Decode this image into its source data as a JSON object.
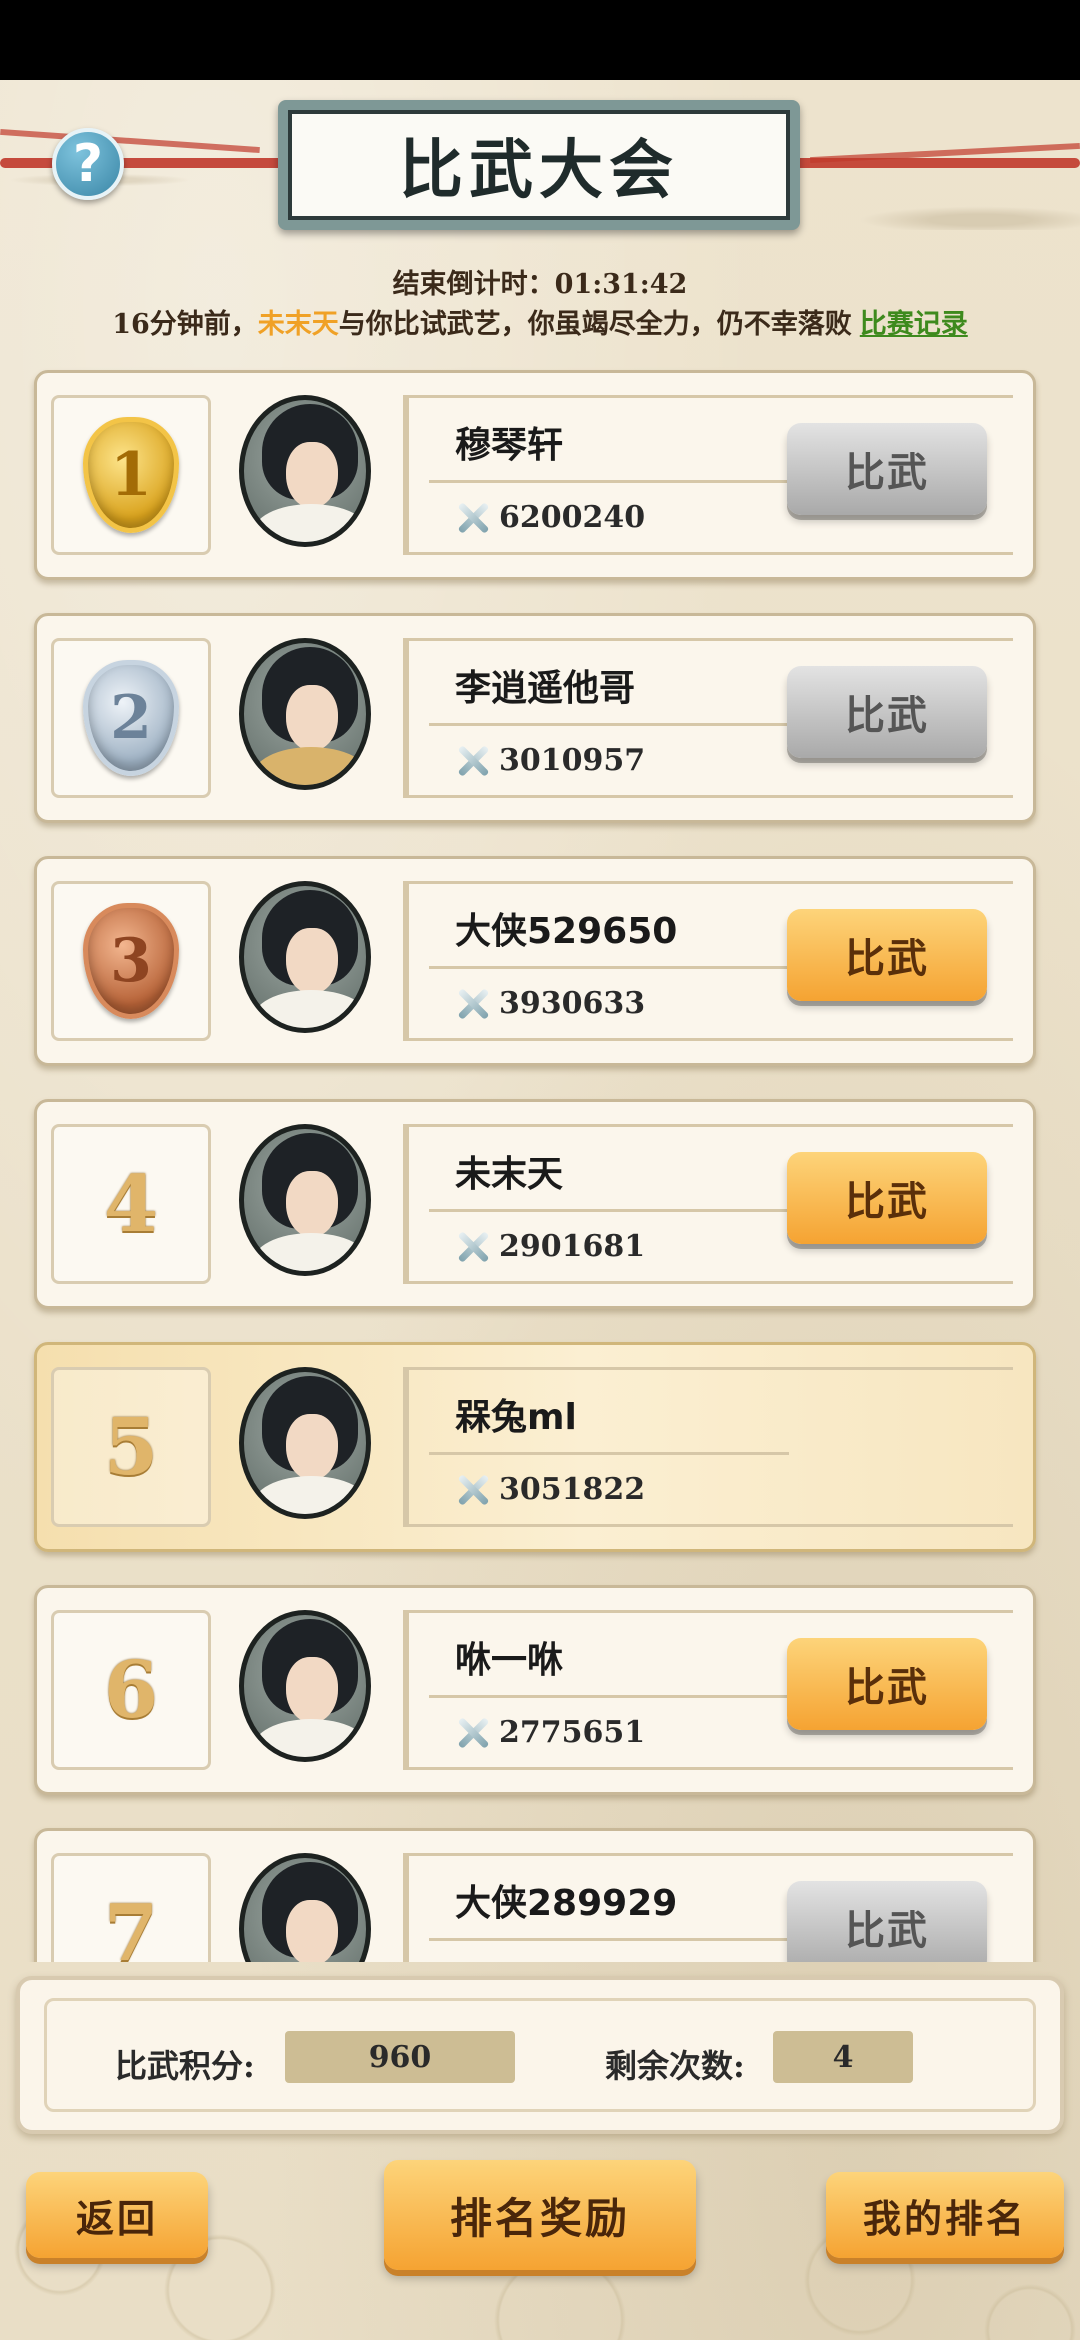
{
  "header": {
    "title": "比武大会",
    "help_label": "?",
    "countdown": "结束倒计时：01:31:42",
    "notice_prefix": "16分钟前，",
    "notice_opponent": "未末天",
    "notice_suffix": "与你比试武艺，你虽竭尽全力，仍不幸落败",
    "record_link": "比赛记录"
  },
  "ranking": [
    {
      "rank": "1",
      "name": "穆琴轩",
      "power": "6200240",
      "button": "比武",
      "button_state": "disabled"
    },
    {
      "rank": "2",
      "name": "李逍遥他哥",
      "power": "3010957",
      "button": "比武",
      "button_state": "disabled"
    },
    {
      "rank": "3",
      "name": "大侠529650",
      "power": "3930633",
      "button": "比武",
      "button_state": "active"
    },
    {
      "rank": "4",
      "name": "未末天",
      "power": "2901681",
      "button": "比武",
      "button_state": "active"
    },
    {
      "rank": "5",
      "name": "槑兔ml",
      "power": "3051822",
      "button": "",
      "button_state": "self"
    },
    {
      "rank": "6",
      "name": "咻一咻",
      "power": "2775651",
      "button": "比武",
      "button_state": "active"
    },
    {
      "rank": "7",
      "name": "大侠289929",
      "power": "",
      "button": "比武",
      "button_state": "disabled"
    }
  ],
  "score_panel": {
    "points_label": "比武积分:",
    "points_value": "960",
    "remaining_label": "剩余次数:",
    "remaining_value": "4"
  },
  "footer": {
    "back": "返回",
    "rewards": "排名奖励",
    "my_rank": "我的排名"
  },
  "colors": {
    "accent_orange": "#f5a332",
    "opponent_highlight": "#f0a126",
    "record_link": "#3e8a1d",
    "disabled_button": "#a9a9a9"
  }
}
